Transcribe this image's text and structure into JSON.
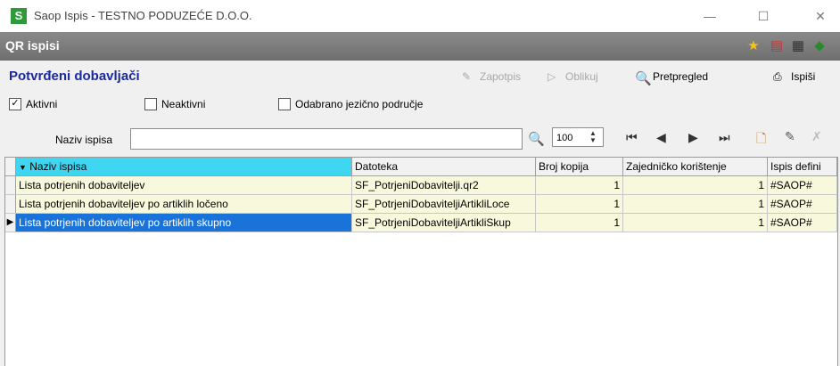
{
  "window": {
    "logo": "S",
    "title": "Saop Ispis - TESTNO PODUZEĆE D.O.O."
  },
  "header": {
    "title": "QR ispisi"
  },
  "section_title": "Potvrđeni dobavljači",
  "toolbar": {
    "sign": "Zapotpis",
    "format": "Oblikuj",
    "preview": "Pretpregled",
    "print": "Ispiši"
  },
  "filters": {
    "active": "Aktivni",
    "inactive": "Neaktivni",
    "language": "Odabrano jezično područje"
  },
  "search": {
    "label": "Naziv ispisa",
    "value": "",
    "zoom": "100"
  },
  "table": {
    "columns": [
      "Naziv ispisa",
      "Datoteka",
      "Broj kopija",
      "Zajedničko korištenje",
      "Ispis defini"
    ],
    "rows": [
      {
        "name": "Lista potrjenih dobaviteljev",
        "file": "SF_PotrjeniDobavitelji.qr2",
        "copies": "1",
        "shared": "1",
        "def": "#SAOP#"
      },
      {
        "name": "Lista potrjenih dobaviteljev po artiklih ločeno",
        "file": "SF_PotrjeniDobaviteljiArtikliLoce",
        "copies": "1",
        "shared": "1",
        "def": "#SAOP#"
      },
      {
        "name": "Lista potrjenih dobaviteljev po artiklih skupno",
        "file": "SF_PotrjeniDobaviteljiArtikliSkup",
        "copies": "1",
        "shared": "1",
        "def": "#SAOP#"
      }
    ]
  }
}
